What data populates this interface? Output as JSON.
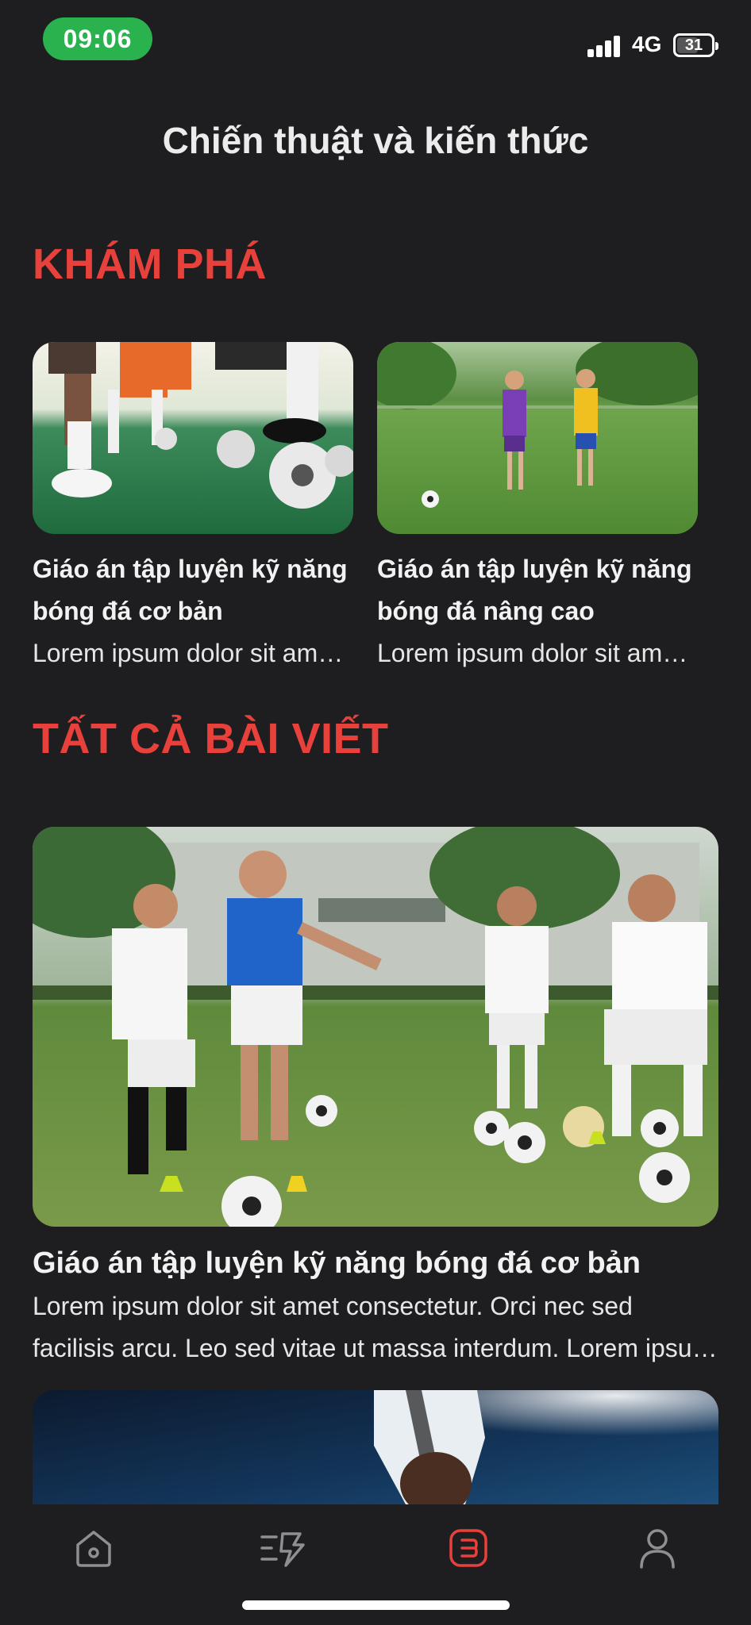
{
  "status_bar": {
    "time": "09:06",
    "network": "4G",
    "battery": "31"
  },
  "page": {
    "title": "Chiến thuật và kiến thức"
  },
  "explore": {
    "section_title": "KHÁM PHÁ",
    "cards": [
      {
        "title": "Giáo án tập luyện kỹ năng bóng đá cơ bản",
        "description": "Lorem ipsum dolor sit amet consectetur."
      },
      {
        "title": "Giáo án tập luyện kỹ năng bóng đá nâng cao",
        "description": "Lorem ipsum dolor sit amet consectetur."
      }
    ]
  },
  "all_articles": {
    "section_title": "TẤT CẢ BÀI VIẾT",
    "articles": [
      {
        "title": "Giáo án tập luyện kỹ năng bóng đá cơ bản",
        "description": "Lorem ipsum dolor sit amet consectetur. Orci nec sed facilisis arcu. Leo sed vitae ut massa interdum. Lorem ipsum dolor sit amet consectetur."
      }
    ]
  },
  "tab_bar": {
    "tabs": [
      {
        "icon": "home-icon",
        "active": false
      },
      {
        "icon": "tactics-icon",
        "active": false
      },
      {
        "icon": "articles-icon",
        "active": true
      },
      {
        "icon": "profile-icon",
        "active": false
      }
    ],
    "active_color": "#e8413c",
    "inactive_color": "#8e8e93"
  },
  "colors": {
    "background": "#1e1e21",
    "accent": "#e8413c",
    "time_pill": "#2ab24f"
  }
}
